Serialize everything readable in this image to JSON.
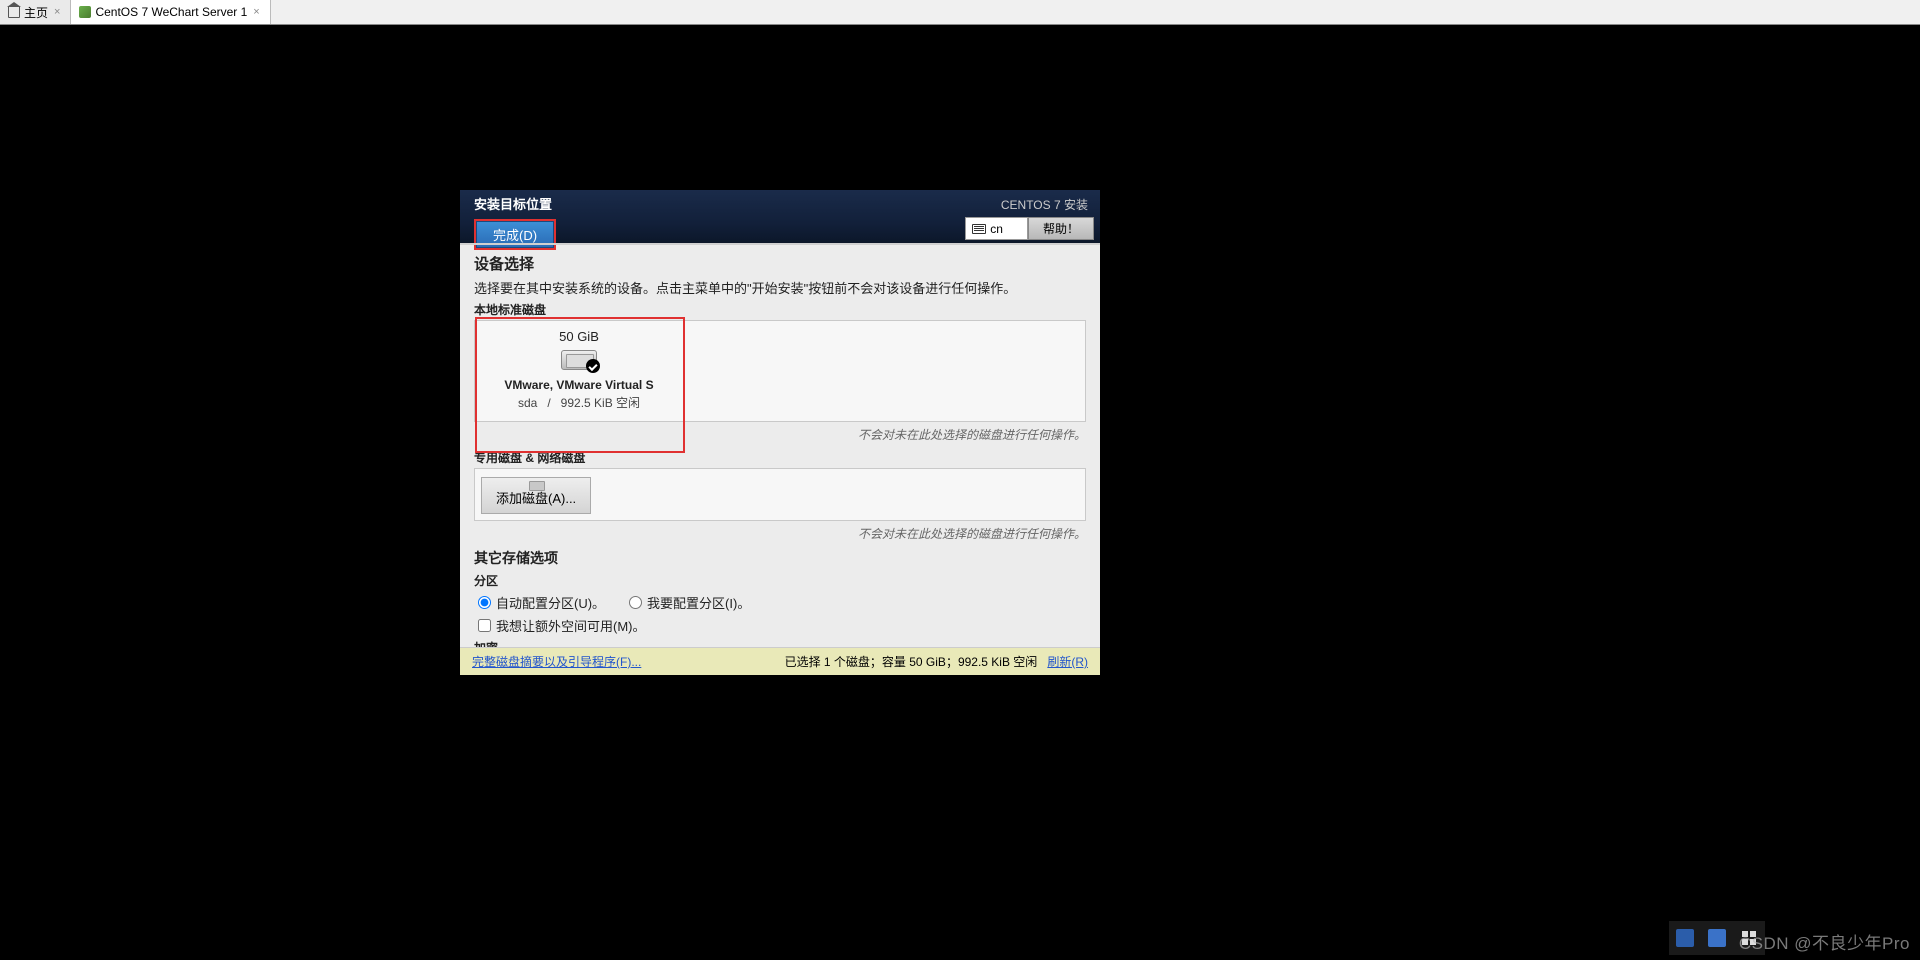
{
  "tabs": [
    {
      "label": "主页",
      "active": false
    },
    {
      "label": "CentOS 7 WeChart Server 1",
      "active": true
    }
  ],
  "dialog": {
    "title": "安装目标位置",
    "done_label": "完成(D)",
    "os_label": "CENTOS 7 安装",
    "lang_code": "cn",
    "help_label": "帮助！"
  },
  "device_selection": {
    "title": "设备选择",
    "description": "选择要在其中安装系统的设备。点击主菜单中的\"开始安装\"按钮前不会对该设备进行任何操作。",
    "local_disks_title": "本地标准磁盘",
    "disk": {
      "size": "50 GiB",
      "model": "VMware, VMware Virtual S",
      "device": "sda",
      "sep": "/",
      "free": "992.5 KiB 空闲"
    },
    "note": "不会对未在此处选择的磁盘进行任何操作。"
  },
  "special_disks": {
    "title": "专用磁盘 & 网络磁盘",
    "add_label": "添加磁盘(A)...",
    "note": "不会对未在此处选择的磁盘进行任何操作。"
  },
  "other_storage": {
    "title": "其它存储选项",
    "partition_title": "分区",
    "auto_partition": "自动配置分区(U)。",
    "manual_partition": "我要配置分区(I)。",
    "extra_space": "我想让额外空间可用(M)。",
    "encryption_title": "加密"
  },
  "footer": {
    "summary_link": "完整磁盘摘要以及引导程序(F)...",
    "status": "已选择 1 个磁盘；容量 50 GiB；992.5 KiB 空闲",
    "refresh_link": "刷新(R)"
  },
  "watermark": "CSDN @不良少年Pro"
}
